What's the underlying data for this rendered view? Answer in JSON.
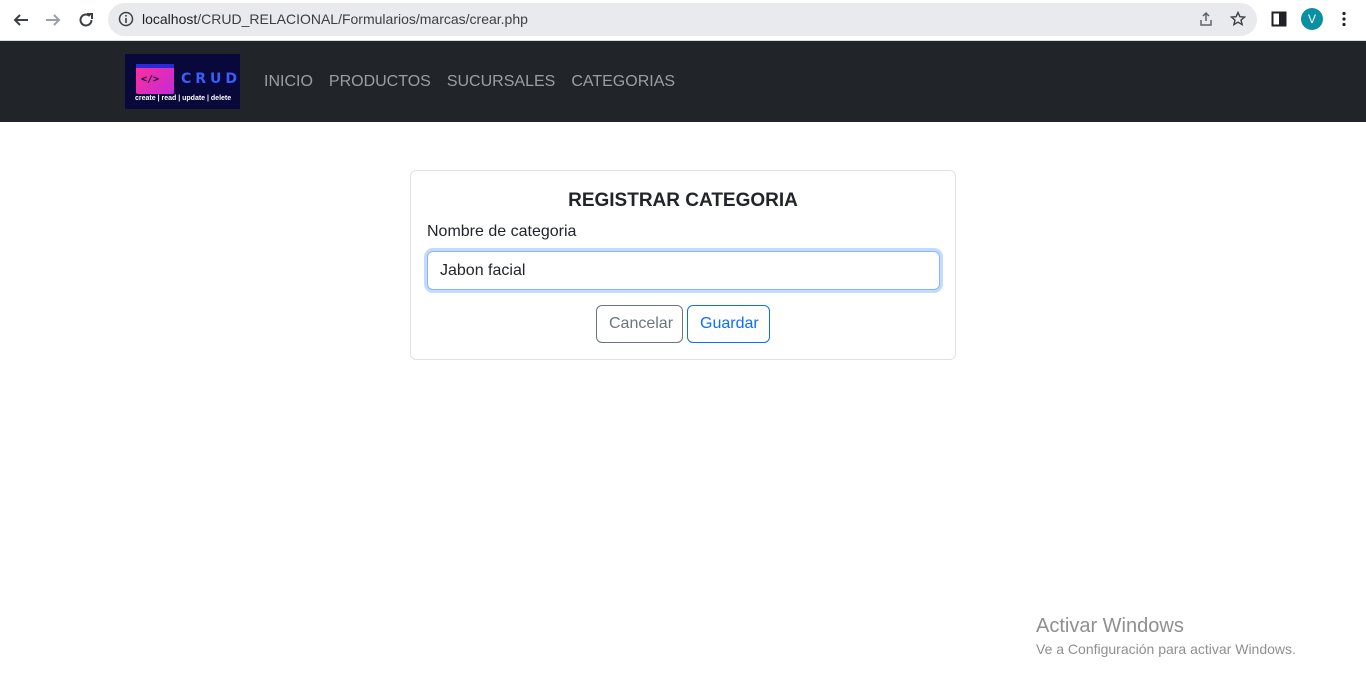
{
  "browser": {
    "url_host": "localhost",
    "url_path": "/CRUD_RELACIONAL/Formularios/marcas/crear.php",
    "profile_initial": "V",
    "icons": [
      "back-icon",
      "forward-icon",
      "reload-icon",
      "info-icon",
      "share-icon",
      "star-icon",
      "side-panel-icon",
      "menu-icon"
    ]
  },
  "navbar": {
    "logo": {
      "code": "</>",
      "word": "CRUD",
      "tagline": "create | read | update | delete"
    },
    "links": [
      "INICIO",
      "PRODUCTOS",
      "SUCURSALES",
      "CATEGORIAS"
    ]
  },
  "form": {
    "title": "REGISTRAR CATEGORIA",
    "label": "Nombre de categoria",
    "input_value": "Jabon facial",
    "cancel_label": "Cancelar",
    "save_label": "Guardar"
  },
  "watermark": {
    "title": "Activar Windows",
    "subtitle": "Ve a Configuración para activar Windows."
  },
  "colors": {
    "navbar_bg": "#212529",
    "primary": "#0d6efd",
    "secondary": "#6c757d",
    "avatar": "#0b8fa3"
  }
}
